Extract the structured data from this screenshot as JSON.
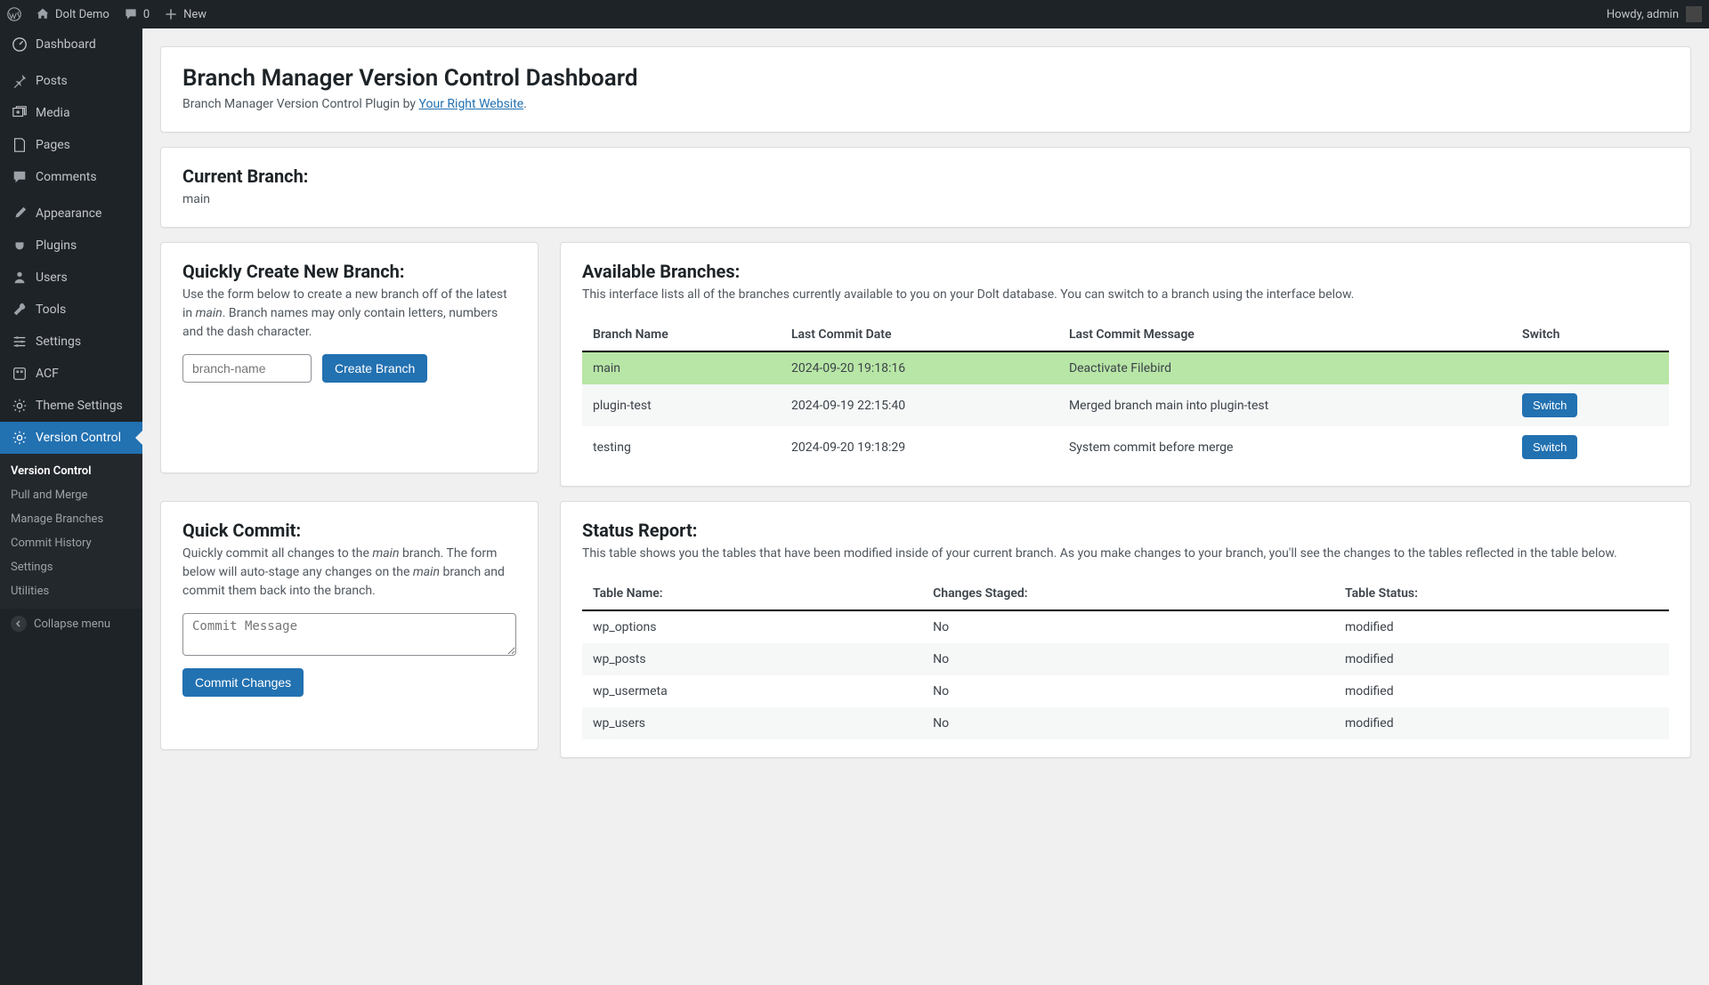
{
  "adminbar": {
    "site_name": "Dolt Demo",
    "comments_count": "0",
    "new_label": "New",
    "howdy": "Howdy, admin"
  },
  "sidebar": {
    "items": [
      {
        "label": "Dashboard"
      },
      {
        "label": "Posts"
      },
      {
        "label": "Media"
      },
      {
        "label": "Pages"
      },
      {
        "label": "Comments"
      },
      {
        "label": "Appearance"
      },
      {
        "label": "Plugins"
      },
      {
        "label": "Users"
      },
      {
        "label": "Tools"
      },
      {
        "label": "Settings"
      },
      {
        "label": "ACF"
      },
      {
        "label": "Theme Settings"
      },
      {
        "label": "Version Control"
      }
    ],
    "submenu": [
      {
        "label": "Version Control"
      },
      {
        "label": "Pull and Merge"
      },
      {
        "label": "Manage Branches"
      },
      {
        "label": "Commit History"
      },
      {
        "label": "Settings"
      },
      {
        "label": "Utilities"
      }
    ],
    "collapse": "Collapse menu"
  },
  "header": {
    "title": "Branch Manager Version Control Dashboard",
    "sub_prefix": "Branch Manager Version Control Plugin by ",
    "sub_link": "Your Right Website"
  },
  "current": {
    "title": "Current Branch:",
    "value": "main"
  },
  "create": {
    "title": "Quickly Create New Branch:",
    "desc_before": "Use the form below to create a new branch off of the latest in ",
    "desc_em": "main",
    "desc_after": ". Branch names may only contain letters, numbers and the dash character.",
    "placeholder": "branch-name",
    "button": "Create Branch"
  },
  "branches": {
    "title": "Available Branches:",
    "desc": "This interface lists all of the branches currently available to you on your Dolt database. You can switch to a branch using the interface below.",
    "cols": {
      "name": "Branch Name",
      "date": "Last Commit Date",
      "msg": "Last Commit Message",
      "switch": "Switch"
    },
    "rows": [
      {
        "name": "main",
        "date": "2024-09-20 19:18:16",
        "msg": "Deactivate Filebird",
        "active": true
      },
      {
        "name": "plugin-test",
        "date": "2024-09-19 22:15:40",
        "msg": "Merged branch main into plugin-test"
      },
      {
        "name": "testing",
        "date": "2024-09-20 19:18:29",
        "msg": "System commit before merge"
      }
    ],
    "switch_btn": "Switch"
  },
  "commit": {
    "title": "Quick Commit:",
    "desc_a": "Quickly commit all changes to the ",
    "desc_b": "main",
    "desc_c": " branch. The form below will auto-stage any changes on the ",
    "desc_d": "main",
    "desc_e": " branch and commit them back into the branch.",
    "placeholder": "Commit Message",
    "button": "Commit Changes"
  },
  "status": {
    "title": "Status Report:",
    "desc": "This table shows you the tables that have been modified inside of your current branch. As you make changes to your branch, you'll see the changes to the tables reflected in the table below.",
    "cols": {
      "table": "Table Name:",
      "staged": "Changes Staged:",
      "status": "Table Status:"
    },
    "rows": [
      {
        "table": "wp_options",
        "staged": "No",
        "status": "modified"
      },
      {
        "table": "wp_posts",
        "staged": "No",
        "status": "modified"
      },
      {
        "table": "wp_usermeta",
        "staged": "No",
        "status": "modified"
      },
      {
        "table": "wp_users",
        "staged": "No",
        "status": "modified"
      }
    ]
  }
}
